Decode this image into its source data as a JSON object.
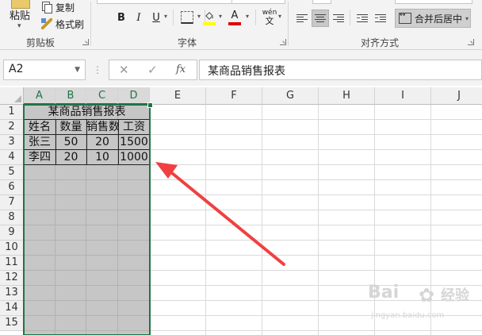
{
  "ribbon": {
    "clipboard": {
      "paste_label": "粘贴",
      "copy_label": "复制",
      "format_painter_label": "格式刷",
      "group_label": "剪贴板"
    },
    "font": {
      "bold": "B",
      "italic": "I",
      "underline": "U",
      "font_color_glyph": "A",
      "phonetic_glyph": "wén",
      "phonetic_char": "文",
      "group_label": "字体",
      "fill_color": "#ffff00",
      "font_color": "#e00000"
    },
    "alignment": {
      "merge_label": "合并后居中",
      "group_label": "对齐方式"
    }
  },
  "formula_bar": {
    "name_box": "A2",
    "cancel_icon": "✕",
    "enter_icon": "✓",
    "fx_icon": "fx",
    "content": "某商品销售报表"
  },
  "sheet": {
    "columns": [
      "A",
      "B",
      "C",
      "D",
      "E",
      "F",
      "G",
      "H",
      "I",
      "J"
    ],
    "rows": [
      "1",
      "2",
      "3",
      "4",
      "5",
      "6",
      "7",
      "8",
      "9",
      "10",
      "11",
      "12",
      "13",
      "14",
      "15"
    ],
    "table": {
      "title": "某商品销售报表",
      "headers": [
        "姓名",
        "数量",
        "销售数量",
        "工资"
      ],
      "rows": [
        [
          "张三",
          "50",
          "20",
          "1500"
        ],
        [
          "李四",
          "20",
          "10",
          "1000"
        ]
      ]
    },
    "selection_color": "#217346",
    "annotation_arrow_color": "#f04040"
  },
  "watermark": {
    "text": "Bai",
    "text2": "经验",
    "sub": "jingyan.baidu.com"
  }
}
